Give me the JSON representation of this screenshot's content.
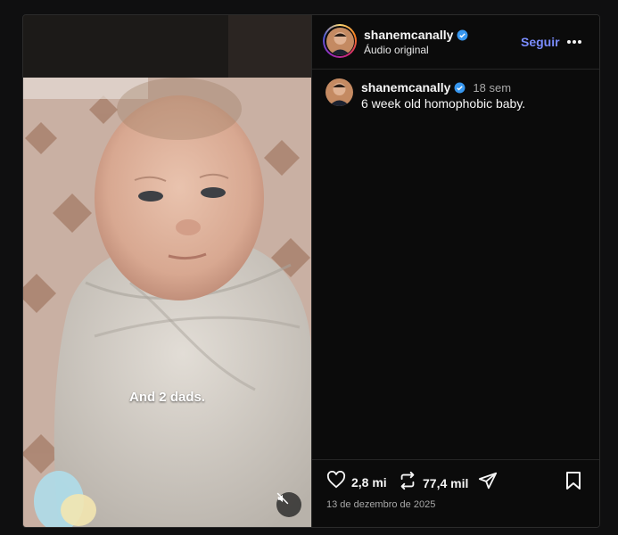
{
  "post": {
    "overlay_caption": "And 2 dads."
  },
  "header": {
    "username": "shanemcanally",
    "audio_label": "Áudio original",
    "follow_label": "Seguir"
  },
  "caption": {
    "username": "shanemcanally",
    "time_ago": "18 sem",
    "text": "6 week old homophobic baby."
  },
  "actions": {
    "likes": "2,8 mi",
    "reposts": "77,4 mil",
    "date": "13 de dezembro de 2025"
  },
  "colors": {
    "accent_link": "#7a8cff",
    "verified_badge": "#3797f0",
    "background": "#0b0b0b"
  },
  "icons": [
    "verified-icon",
    "more-options-icon",
    "heart-icon",
    "repost-icon",
    "share-icon",
    "bookmark-icon",
    "muted-speaker-icon"
  ]
}
